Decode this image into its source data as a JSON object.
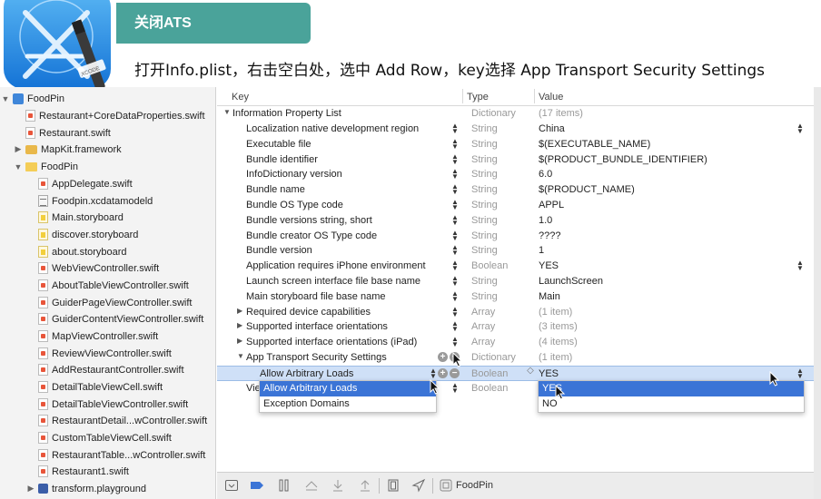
{
  "banner": {
    "title": "关闭ATS",
    "instruction": "打开Info.plist，右击空白处，选中 Add Row，key选择 App Transport Security Settings",
    "app_icon_label": "XCODE"
  },
  "navigator": {
    "items": [
      {
        "label": "FoodPin",
        "icon": "project-icon",
        "disclosure": "▼"
      },
      {
        "label": "Restaurant+CoreDataProperties.swift",
        "icon": "swift-file-icon"
      },
      {
        "label": "Restaurant.swift",
        "icon": "swift-file-icon"
      },
      {
        "label": "MapKit.framework",
        "icon": "framework-icon",
        "disclosure": "▶"
      },
      {
        "label": "FoodPin",
        "icon": "folder-icon",
        "disclosure": "▼"
      },
      {
        "label": "AppDelegate.swift",
        "icon": "swift-file-icon"
      },
      {
        "label": "Foodpin.xcdatamodeld",
        "icon": "data-model-icon"
      },
      {
        "label": "Main.storyboard",
        "icon": "storyboard-icon"
      },
      {
        "label": "discover.storyboard",
        "icon": "storyboard-icon"
      },
      {
        "label": "about.storyboard",
        "icon": "storyboard-icon"
      },
      {
        "label": "WebViewController.swift",
        "icon": "swift-file-icon"
      },
      {
        "label": "AboutTableViewController.swift",
        "icon": "swift-file-icon"
      },
      {
        "label": "GuiderPageViewController.swift",
        "icon": "swift-file-icon"
      },
      {
        "label": "GuiderContentViewController.swift",
        "icon": "swift-file-icon"
      },
      {
        "label": "MapViewController.swift",
        "icon": "swift-file-icon"
      },
      {
        "label": "ReviewViewController.swift",
        "icon": "swift-file-icon"
      },
      {
        "label": "AddRestaurantController.swift",
        "icon": "swift-file-icon"
      },
      {
        "label": "DetailTableViewCell.swift",
        "icon": "swift-file-icon"
      },
      {
        "label": "DetailTableViewController.swift",
        "icon": "swift-file-icon"
      },
      {
        "label": "RestaurantDetail...wController.swift",
        "icon": "swift-file-icon"
      },
      {
        "label": "CustomTableViewCell.swift",
        "icon": "swift-file-icon"
      },
      {
        "label": "RestaurantTable...wController.swift",
        "icon": "swift-file-icon"
      },
      {
        "label": "Restaurant1.swift",
        "icon": "swift-file-icon"
      },
      {
        "label": "transform.playground",
        "icon": "playground-icon",
        "disclosure": "▶"
      }
    ]
  },
  "plist": {
    "headers": {
      "key": "Key",
      "type": "Type",
      "value": "Value"
    },
    "root": {
      "key": "Information Property List",
      "type": "Dictionary",
      "value": "(17 items)"
    },
    "rows": [
      {
        "key": "Localization native development region",
        "type": "String",
        "value": "China"
      },
      {
        "key": "Executable file",
        "type": "String",
        "value": "$(EXECUTABLE_NAME)"
      },
      {
        "key": "Bundle identifier",
        "type": "String",
        "value": "$(PRODUCT_BUNDLE_IDENTIFIER)"
      },
      {
        "key": "InfoDictionary version",
        "type": "String",
        "value": "6.0"
      },
      {
        "key": "Bundle name",
        "type": "String",
        "value": "$(PRODUCT_NAME)"
      },
      {
        "key": "Bundle OS Type code",
        "type": "String",
        "value": "APPL"
      },
      {
        "key": "Bundle versions string, short",
        "type": "String",
        "value": "1.0"
      },
      {
        "key": "Bundle creator OS Type code",
        "type": "String",
        "value": "????"
      },
      {
        "key": "Bundle version",
        "type": "String",
        "value": "1"
      },
      {
        "key": "Application requires iPhone environment",
        "type": "Boolean",
        "value": "YES"
      },
      {
        "key": "Launch screen interface file base name",
        "type": "String",
        "value": "LaunchScreen"
      },
      {
        "key": "Main storyboard file base name",
        "type": "String",
        "value": "Main"
      },
      {
        "key": "Required device capabilities",
        "type": "Array",
        "value": "(1 item)"
      },
      {
        "key": "Supported interface orientations",
        "type": "Array",
        "value": "(3 items)"
      },
      {
        "key": "Supported interface orientations (iPad)",
        "type": "Array",
        "value": "(4 items)"
      },
      {
        "key": "App Transport Security Settings",
        "type": "Dictionary",
        "value": "(1 item)"
      },
      {
        "key": "Allow Arbitrary Loads",
        "type": "Boolean",
        "value": "YES"
      },
      {
        "key": "Vie",
        "type": "Boolean",
        "value": ""
      }
    ],
    "key_popup": {
      "options": [
        "Allow Arbitrary Loads",
        "Exception Domains"
      ],
      "selected": 0
    },
    "value_popup": {
      "options": [
        "YES",
        "NO"
      ],
      "selected": 0
    }
  },
  "toolbar": {
    "scheme_label": "FoodPin",
    "buttons": [
      "filter-icon",
      "breakpoint-icon",
      "pause-icon",
      "step-over-icon",
      "step-in-icon",
      "step-out-icon",
      "view-debugger-icon",
      "location-icon"
    ]
  },
  "colors": {
    "banner_accent": "#4aa39a",
    "selection": "#cfe0f7",
    "popup_highlight": "#3b74d6",
    "xcode_blue": "#1c86e8"
  }
}
